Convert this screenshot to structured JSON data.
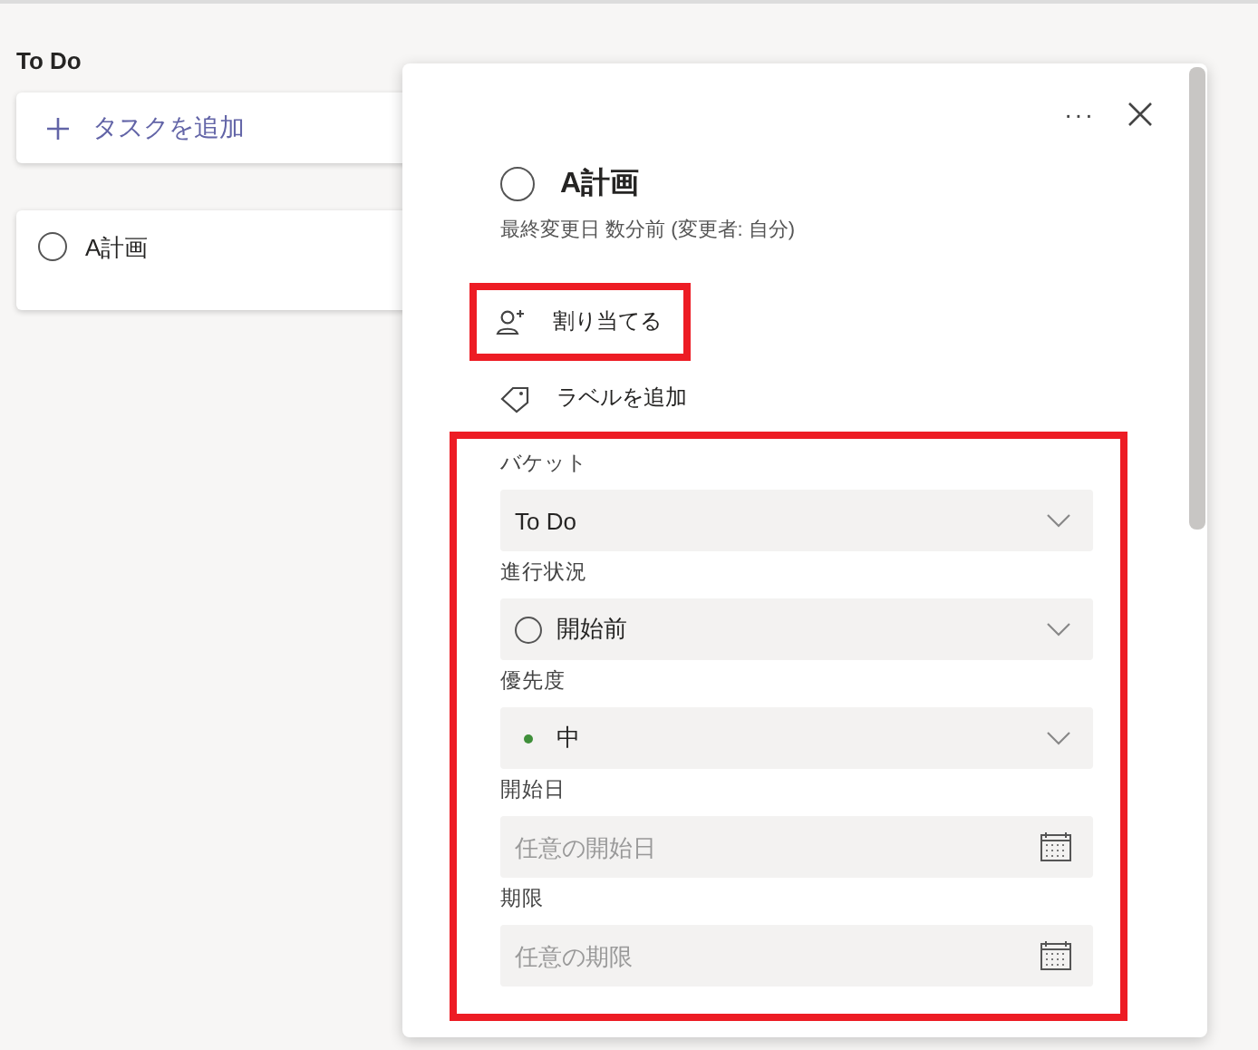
{
  "board": {
    "bucket_title": "To Do",
    "add_task": "タスクを追加",
    "tasks": [
      {
        "title": "A計画",
        "completed": false
      }
    ]
  },
  "details": {
    "more": "···",
    "title": "A計画",
    "completed": false,
    "modified": "最終変更日 数分前 (変更者: 自分)",
    "assign": {
      "label": "割り当てる",
      "highlighted": true
    },
    "add_label": "ラベルを追加",
    "fields_highlighted": true,
    "fields": [
      {
        "kind": "select",
        "label": "バケット",
        "value": "To Do"
      },
      {
        "kind": "status",
        "label": "進行状況",
        "value": "開始前"
      },
      {
        "kind": "priority",
        "label": "優先度",
        "value": "中",
        "color": "#3f8f3a"
      },
      {
        "kind": "date",
        "label": "開始日",
        "placeholder": "任意の開始日"
      },
      {
        "kind": "date",
        "label": "期限",
        "placeholder": "任意の期限"
      }
    ]
  }
}
